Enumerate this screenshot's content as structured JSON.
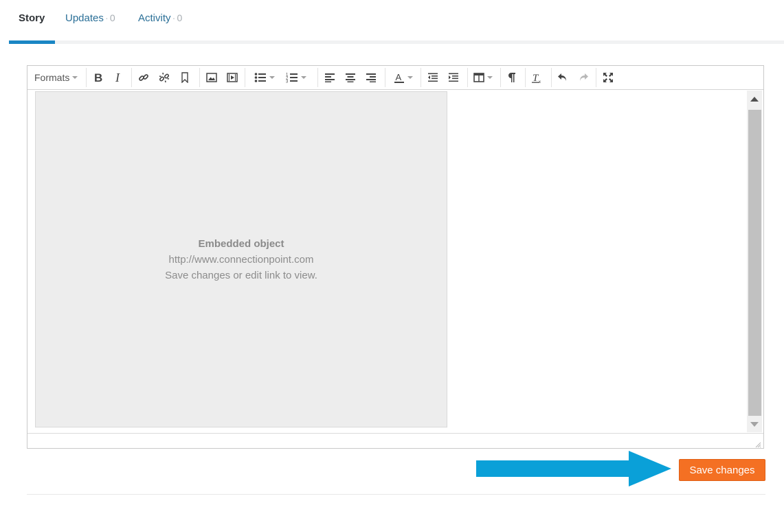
{
  "tabs": [
    {
      "label": "Story",
      "active": true
    },
    {
      "label": "Updates",
      "count": "0",
      "separator": "·"
    },
    {
      "label": "Activity",
      "count": "0",
      "separator": "·"
    }
  ],
  "toolbar": {
    "formats_label": "Formats",
    "buttons": [
      "bold-icon",
      "italic-icon",
      "link-icon",
      "unlink-icon",
      "bookmark-icon",
      "image-icon",
      "media-icon",
      "bullet-list-icon",
      "numbered-list-icon",
      "align-left-icon",
      "align-center-icon",
      "align-right-icon",
      "text-color-icon",
      "outdent-icon",
      "indent-icon",
      "table-icon",
      "paragraph-icon",
      "clear-formatting-icon",
      "undo-icon",
      "redo-icon",
      "fullscreen-icon"
    ]
  },
  "embed": {
    "title": "Embedded object",
    "url": "http://www.connectionpoint.com",
    "hint": "Save changes or edit link to view."
  },
  "actions": {
    "save_label": "Save changes"
  },
  "colors": {
    "accent_blue": "#1a86c4",
    "arrow_blue": "#0aa0d8",
    "save_orange": "#f47023",
    "tab_link": "#2a6f97"
  }
}
